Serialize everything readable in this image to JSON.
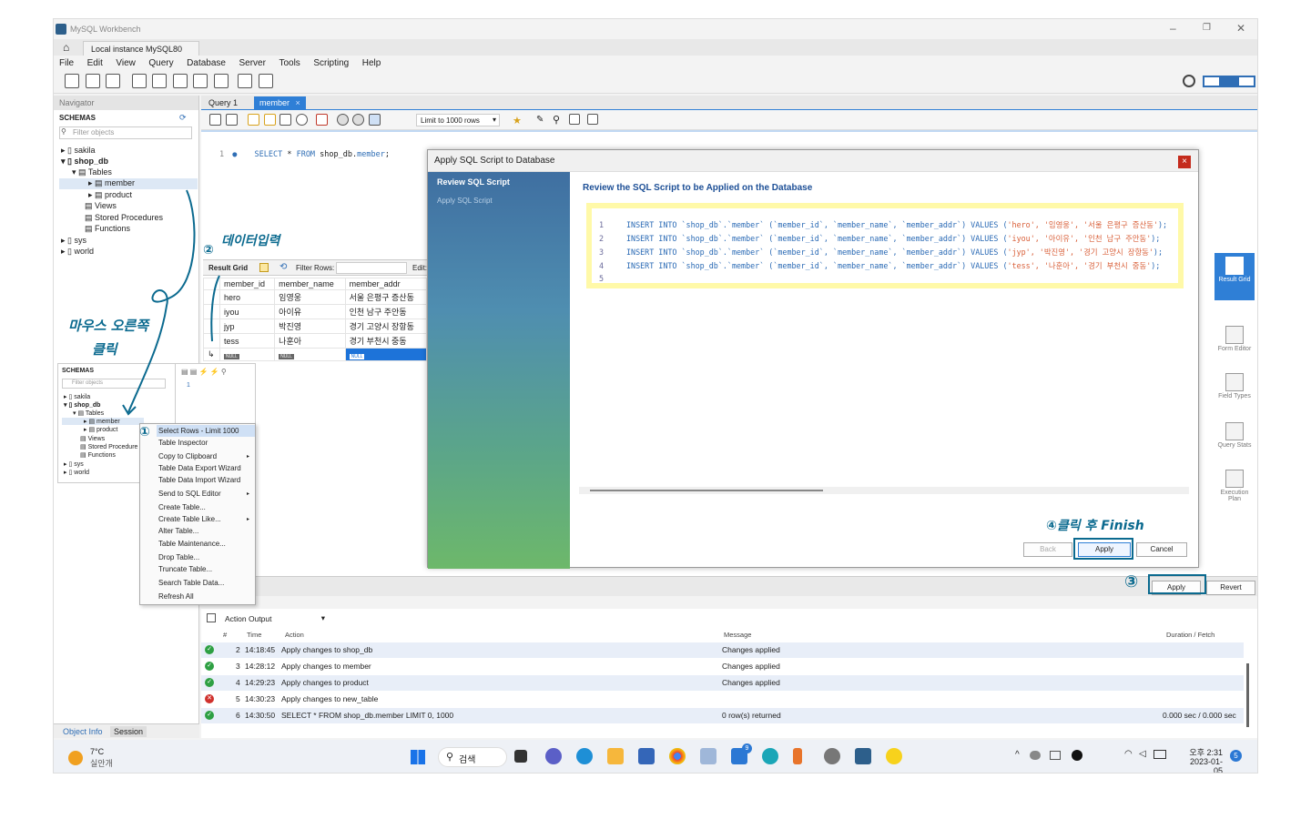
{
  "window": {
    "app_title": "MySQL Workbench",
    "instance_tab": "Local instance MySQL80"
  },
  "menu": [
    "File",
    "Edit",
    "View",
    "Query",
    "Database",
    "Server",
    "Tools",
    "Scripting",
    "Help"
  ],
  "navigator": {
    "header": "Navigator",
    "schemas_label": "SCHEMAS",
    "filter_placeholder": "Filter objects",
    "tree": {
      "sakila": "sakila",
      "shop_db": "shop_db",
      "tables": "Tables",
      "member": "member",
      "product": "product",
      "views": "Views",
      "stored_procedures": "Stored Procedures",
      "functions": "Functions",
      "sys": "sys",
      "world": "world"
    },
    "bottom_tabs": [
      "Object Info",
      "Session"
    ]
  },
  "editor": {
    "tabs": [
      "Query 1",
      "member"
    ],
    "limit_label": "Limit to 1000 rows",
    "line_no": "1",
    "sql": "SELECT * FROM shop_db.member;",
    "sql_kw1": "SELECT",
    "sql_mid": " * ",
    "sql_kw2": "FROM",
    "sql_obj": " shop_db.",
    "sql_table": "member",
    "sql_end": ";"
  },
  "result_grid": {
    "label": "Result Grid",
    "filter_label": "Filter Rows:",
    "edit_label": "Edit:",
    "columns": [
      "member_id",
      "member_name",
      "member_addr"
    ],
    "rows": [
      [
        "hero",
        "임영웅",
        "서울 은평구 증산동"
      ],
      [
        "iyou",
        "아이유",
        "인천 남구 주안동"
      ],
      [
        "jyp",
        "박진영",
        "경기 고양시 장항동"
      ],
      [
        "tess",
        "나훈아",
        "경기 부천시 중동"
      ]
    ],
    "null_label": "NULL"
  },
  "right_panel": [
    {
      "label": "Result Grid",
      "active": true
    },
    {
      "label": "Form Editor",
      "active": false
    },
    {
      "label": "Field Types",
      "active": false
    },
    {
      "label": "Query Stats",
      "active": false
    },
    {
      "label": "Execution Plan",
      "active": false
    }
  ],
  "dialog": {
    "title": "Apply SQL Script to Database",
    "close": "×",
    "steps": [
      "Review SQL Script",
      "Apply SQL Script"
    ],
    "heading": "Review the SQL Script to be Applied on the Database",
    "sql_lines": [
      {
        "n": "1",
        "pre": "INSERT INTO `shop_db`.`member` (`member_id`, `member_name`, `member_addr`) VALUES (",
        "vals": "'hero', '임영웅', '서울 은평구 증산동'",
        "post": ");"
      },
      {
        "n": "2",
        "pre": "INSERT INTO `shop_db`.`member` (`member_id`, `member_name`, `member_addr`) VALUES (",
        "vals": "'iyou', '아이유', '인천 남구 주안동'",
        "post": ");"
      },
      {
        "n": "3",
        "pre": "INSERT INTO `shop_db`.`member` (`member_id`, `member_name`, `member_addr`) VALUES (",
        "vals": "'jyp', '박진영', '경기 고양시 장항동'",
        "post": ");"
      },
      {
        "n": "4",
        "pre": "INSERT INTO `shop_db`.`member` (`member_id`, `member_name`, `member_addr`) VALUES (",
        "vals": "'tess', '나훈아', '경기 부천시 중동'",
        "post": ");"
      },
      {
        "n": "5",
        "pre": "",
        "vals": "",
        "post": ""
      }
    ],
    "back": "Back",
    "apply": "Apply",
    "cancel": "Cancel"
  },
  "bottom_buttons": {
    "apply": "Apply",
    "revert": "Revert"
  },
  "context_menu": [
    "Select Rows - Limit 1000",
    "Table Inspector",
    "Copy to Clipboard",
    "Table Data Export Wizard",
    "Table Data Import Wizard",
    "Send to SQL Editor",
    "Create Table...",
    "Create Table Like...",
    "Alter Table...",
    "Table Maintenance...",
    "Drop Table...",
    "Truncate Table...",
    "Search Table Data...",
    "Refresh All"
  ],
  "mini_nav": {
    "schemas_label": "SCHEMAS",
    "filter_placeholder": "Filter objects",
    "sakila": "sakila",
    "shop_db": "shop_db",
    "tables": "Tables",
    "member": "member",
    "product": "product",
    "views": "Views",
    "stored_procedures": "Stored Procedure",
    "functions": "Functions",
    "sys": "sys",
    "world": "world",
    "line_no": "1"
  },
  "output": {
    "selector": "Action Output",
    "columns": [
      "#",
      "Time",
      "Action",
      "Message",
      "Duration / Fetch"
    ],
    "rows": [
      {
        "status": "ok",
        "n": "2",
        "time": "14:18:45",
        "action": "Apply changes to shop_db",
        "message": "Changes applied",
        "duration": ""
      },
      {
        "status": "ok",
        "n": "3",
        "time": "14:28:12",
        "action": "Apply changes to member",
        "message": "Changes applied",
        "duration": ""
      },
      {
        "status": "ok",
        "n": "4",
        "time": "14:29:23",
        "action": "Apply changes to product",
        "message": "Changes applied",
        "duration": ""
      },
      {
        "status": "error",
        "n": "5",
        "time": "14:30:23",
        "action": "Apply changes to new_table",
        "message": "",
        "duration": ""
      },
      {
        "status": "ok",
        "n": "6",
        "time": "14:30:50",
        "action": "SELECT * FROM shop_db.member LIMIT 0, 1000",
        "message": "0 row(s) returned",
        "duration": "0.000 sec / 0.000 sec"
      }
    ]
  },
  "taskbar": {
    "temp": "7°C",
    "weather": "실안개",
    "search": "검색",
    "time": "오후 2:31",
    "date": "2023-01-05",
    "mail_badge": "9",
    "notif_badge": "5"
  },
  "annotations": {
    "a1": "①",
    "a2": "②",
    "a2_text": "데이터입력",
    "a3": "③",
    "a4": "④클릭 후 Finish",
    "note_line1": "마우스 오른쪽",
    "note_line2": "클릭"
  },
  "colors": {
    "accent": "#2f6eb5",
    "annotation": "#0b6a8f",
    "highlight": "#fff9a8",
    "ok": "#2ea043",
    "error": "#d0312d"
  }
}
